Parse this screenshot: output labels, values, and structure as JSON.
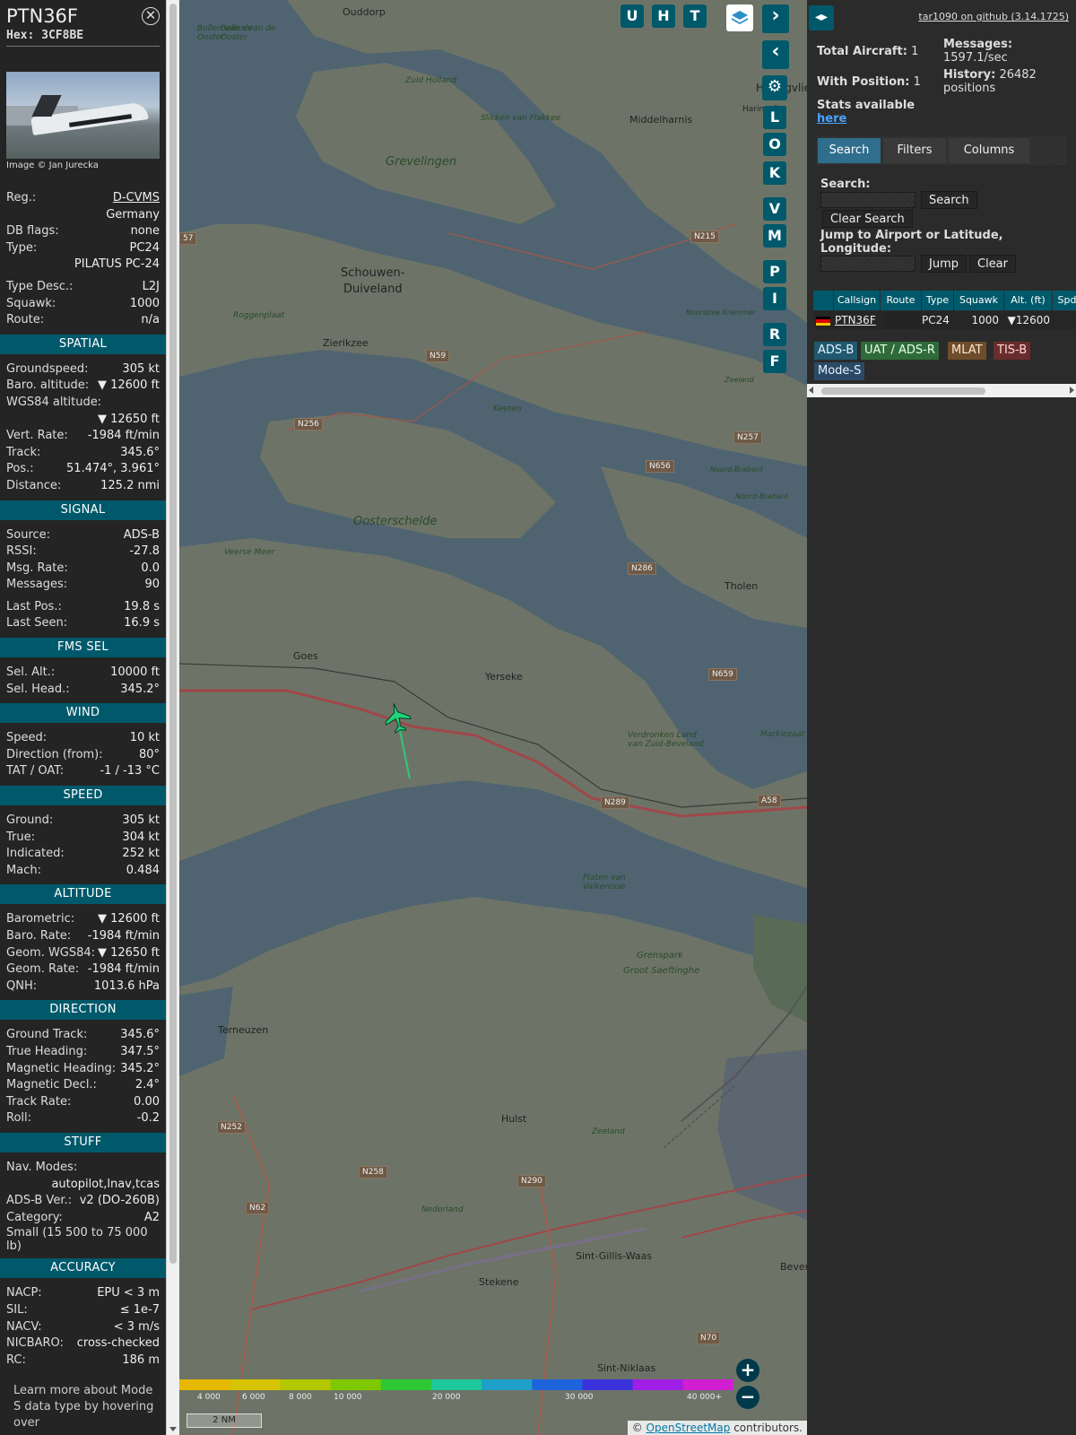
{
  "aircraft": {
    "callsign": "PTN36F",
    "hex_label": "Hex:",
    "hex": "3CF8BE",
    "close_symbol": "⊗",
    "photo_credit": "Image © Jan Jurecka"
  },
  "details": [
    {
      "k": "Reg.:",
      "v": "D-CVMS",
      "link": true
    },
    {
      "k": "",
      "v": "Germany"
    },
    {
      "k": "DB flags:",
      "v": "none"
    },
    {
      "k": "Type:",
      "v": "PC24"
    },
    {
      "k": "",
      "v": "PILATUS PC-24"
    },
    {
      "k": "Type Desc.:",
      "v": "L2J",
      "gap": true
    },
    {
      "k": "Squawk:",
      "v": "1000"
    },
    {
      "k": "Route:",
      "v": "n/a"
    }
  ],
  "sections": [
    {
      "title": "SPATIAL",
      "rows": [
        {
          "k": "Groundspeed:",
          "v": "305 kt"
        },
        {
          "k": "Baro. altitude:",
          "v": "▼ 12600 ft"
        },
        {
          "k": "WGS84 altitude:",
          "v": ""
        },
        {
          "k": "",
          "v": "▼ 12650 ft"
        },
        {
          "k": "Vert. Rate:",
          "v": "-1984 ft/min"
        },
        {
          "k": "Track:",
          "v": "345.6°"
        },
        {
          "k": "Pos.:",
          "v": "51.474°, 3.961°"
        },
        {
          "k": "Distance:",
          "v": "125.2 nmi"
        }
      ]
    },
    {
      "title": "SIGNAL",
      "rows": [
        {
          "k": "Source:",
          "v": "ADS-B"
        },
        {
          "k": "RSSI:",
          "v": "-27.8"
        },
        {
          "k": "Msg. Rate:",
          "v": "0.0"
        },
        {
          "k": "Messages:",
          "v": "90"
        },
        {
          "k": "Last Pos.:",
          "v": "19.8 s",
          "gap": true
        },
        {
          "k": "Last Seen:",
          "v": "16.9 s"
        }
      ]
    },
    {
      "title": "FMS SEL",
      "rows": [
        {
          "k": "Sel. Alt.:",
          "v": "10000 ft"
        },
        {
          "k": "Sel. Head.:",
          "v": "345.2°"
        }
      ]
    },
    {
      "title": "WIND",
      "rows": [
        {
          "k": "Speed:",
          "v": "10 kt"
        },
        {
          "k": "Direction (from):",
          "v": "80°"
        },
        {
          "k": "TAT / OAT:",
          "v": "-1 / -13 °C"
        }
      ]
    },
    {
      "title": "SPEED",
      "rows": [
        {
          "k": "Ground:",
          "v": "305 kt"
        },
        {
          "k": "True:",
          "v": "304 kt"
        },
        {
          "k": "Indicated:",
          "v": "252 kt"
        },
        {
          "k": "Mach:",
          "v": "0.484"
        }
      ]
    },
    {
      "title": "ALTITUDE",
      "rows": [
        {
          "k": "Barometric:",
          "v": "▼ 12600 ft"
        },
        {
          "k": "Baro. Rate:",
          "v": "-1984 ft/min"
        },
        {
          "k": "Geom. WGS84:",
          "v": "▼ 12650 ft"
        },
        {
          "k": "Geom. Rate:",
          "v": "-1984 ft/min"
        },
        {
          "k": "QNH:",
          "v": "1013.6 hPa"
        }
      ]
    },
    {
      "title": "DIRECTION",
      "rows": [
        {
          "k": "Ground Track:",
          "v": "345.6°"
        },
        {
          "k": "True Heading:",
          "v": "347.5°"
        },
        {
          "k": "Magnetic Heading:",
          "v": "345.2°"
        },
        {
          "k": "Magnetic Decl.:",
          "v": "2.4°"
        },
        {
          "k": "Track Rate:",
          "v": "0.00"
        },
        {
          "k": "Roll:",
          "v": "-0.2"
        }
      ]
    },
    {
      "title": "STUFF",
      "rows": [
        {
          "k": "Nav. Modes:",
          "v": ""
        },
        {
          "k": "",
          "v": "autopilot,lnav,tcas"
        },
        {
          "k": "ADS-B Ver.:",
          "v": "v2 (DO-260B)"
        },
        {
          "k": "Category:",
          "v": "A2"
        },
        {
          "k": "Small (15 500 to 75 000 lb)",
          "v": "",
          "twoline": true
        }
      ]
    },
    {
      "title": "ACCURACY",
      "rows": [
        {
          "k": "NACP:",
          "v": "EPU < 3 m"
        },
        {
          "k": "SIL:",
          "v": "≤ 1e-7"
        },
        {
          "k": "NACV:",
          "v": "< 3 m/s"
        },
        {
          "k": "NICBARO:",
          "v": "cross-checked"
        },
        {
          "k": "RC:",
          "v": "186 m"
        }
      ]
    }
  ],
  "learn_more": "Learn more about Mode S data type by hovering over",
  "map": {
    "labels": [
      {
        "t": "Ouddorp"
      },
      {
        "t": "Bollen van de Ooster"
      },
      {
        "t": "Bollen van de Ooster"
      },
      {
        "t": "Haringvliet"
      },
      {
        "t": "Middelharnis"
      },
      {
        "t": "Haringvliet"
      },
      {
        "t": "Grevelingen"
      },
      {
        "t": "Slikken van Flakkee"
      },
      {
        "t": "Zuid Holland"
      },
      {
        "t": "Schouwen-"
      },
      {
        "t": "Duiveland"
      },
      {
        "t": "Roggenplaat"
      },
      {
        "t": "Zierikzee"
      },
      {
        "t": "Keeten"
      },
      {
        "t": "Oosterschelde"
      },
      {
        "t": "Veerse Meer"
      },
      {
        "t": "Tholen"
      },
      {
        "t": "Goes"
      },
      {
        "t": "Yerseke"
      },
      {
        "t": "Verdronken Land van Zuid-Beveland"
      },
      {
        "t": "Markiezaat"
      },
      {
        "t": "Platen van Valkenisse"
      },
      {
        "t": "Grenspark"
      },
      {
        "t": "Groot Saeftinghe"
      },
      {
        "t": "Terneuzen"
      },
      {
        "t": "Hulst"
      },
      {
        "t": "Zeeland"
      },
      {
        "t": "Nederland"
      },
      {
        "t": "Sint-Gillis-Waas"
      },
      {
        "t": "Stekene"
      },
      {
        "t": "Sint-Niklaas"
      },
      {
        "t": "Beveren"
      },
      {
        "t": "Noordzee Krammer"
      },
      {
        "t": "Noord-Brabant"
      },
      {
        "t": "Zeeland"
      },
      {
        "t": "Noord-Brabant"
      }
    ],
    "road_shields": [
      "N215",
      "N59",
      "N256",
      "N257",
      "N656",
      "N286",
      "N659",
      "N289",
      "A58",
      "N252",
      "N258",
      "N290",
      "N62",
      "N70",
      "57"
    ],
    "side_buttons": [
      "L",
      "O",
      "K",
      "V",
      "M",
      "P",
      "I",
      "R",
      "F"
    ],
    "top_buttons": [
      "U",
      "H",
      "T"
    ],
    "altitude_scale": [
      "4 000",
      "6 000",
      "8 000",
      "10 000",
      "20 000",
      "30 000",
      "40 000+"
    ],
    "altitude_colors": [
      "#e6b800",
      "#d6c400",
      "#b4c800",
      "#7ec800",
      "#2ec832",
      "#1ec89b",
      "#1ea0c8",
      "#1e64dc",
      "#3c32dc",
      "#a01ee6",
      "#d21ed2"
    ],
    "scale_label": "2 NM",
    "attribution_prefix": "©",
    "attribution_link": "OpenStreetMap",
    "attribution_suffix": "contributors."
  },
  "sidebar": {
    "github": "tar1090 on github (3.14.1725)",
    "total_aircraft_label": "Total Aircraft:",
    "total_aircraft": "1",
    "with_position_label": "With Position:",
    "with_position": "1",
    "stats_label": "Stats available",
    "stats_link": "here",
    "messages_label": "Messages:",
    "messages_value": "1597.1/sec",
    "history_label": "History:",
    "history_value": "26482 positions",
    "tabs": [
      "Search",
      "Filters",
      "Columns"
    ],
    "search_label": "Search:",
    "search_button": "Search",
    "clear_search_button": "Clear Search",
    "jump_label": "Jump to Airport or Latitude, Longitude:",
    "jump_button": "Jump",
    "clear_button": "Clear",
    "columns": [
      "Callsign",
      "Route",
      "Type",
      "Squawk",
      "Alt. (ft)",
      "Spd"
    ],
    "row": {
      "callsign": "PTN36F",
      "route": "",
      "type": "PC24",
      "squawk": "1000",
      "alt": "▼12600"
    },
    "legend": [
      {
        "label": "ADS-B",
        "bg": "#1f5a6e",
        "fg": "#e6f0ff"
      },
      {
        "label": "UAT / ADS-R",
        "bg": "#2f6b3a",
        "fg": "#e8ffe8"
      },
      {
        "label": "MLAT",
        "bg": "#6e4d2c",
        "fg": "#ffe8cc"
      },
      {
        "label": "TIS-B",
        "bg": "#6a2d2d",
        "fg": "#ffd6d6"
      },
      {
        "label": "Mode-S",
        "bg": "#2b4a66",
        "fg": "#e6f0ff"
      }
    ]
  }
}
